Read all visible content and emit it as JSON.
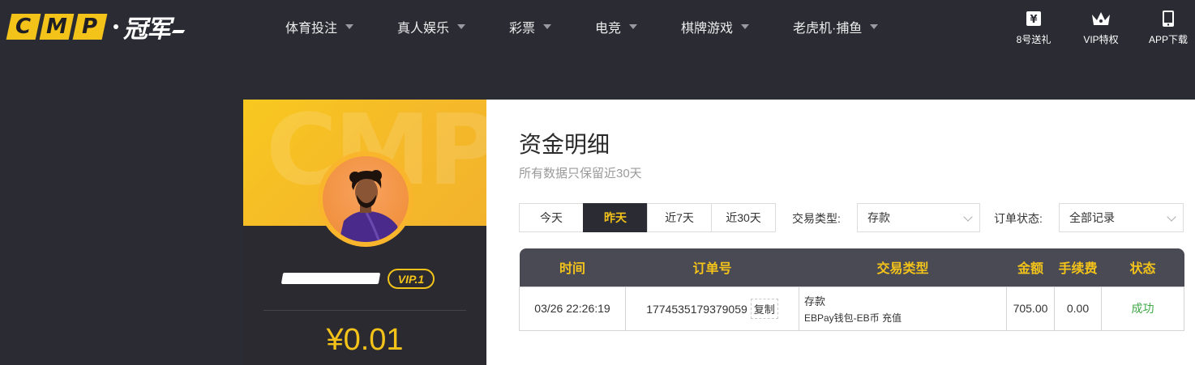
{
  "header": {
    "logo_letters": [
      "C",
      "M",
      "P"
    ],
    "logo_cn": "冠军",
    "nav": [
      {
        "label": "体育投注"
      },
      {
        "label": "真人娱乐"
      },
      {
        "label": "彩票"
      },
      {
        "label": "电竞"
      },
      {
        "label": "棋牌游戏"
      },
      {
        "label": "老虎机·捕鱼"
      }
    ],
    "tools": [
      {
        "label": "8号送礼",
        "icon": "yen-gift-icon"
      },
      {
        "label": "VIP特权",
        "icon": "crown-icon"
      },
      {
        "label": "APP下载",
        "icon": "phone-icon"
      }
    ]
  },
  "profile": {
    "watermark": "CMP",
    "vip": "VIP.1",
    "balance": "¥0.01"
  },
  "main": {
    "title": "资金明细",
    "subtitle": "所有数据只保留近30天",
    "range_tabs": [
      {
        "label": "今天",
        "active": false
      },
      {
        "label": "昨天",
        "active": true
      },
      {
        "label": "近7天",
        "active": false
      },
      {
        "label": "近30天",
        "active": false
      }
    ],
    "txn_type_label": "交易类型:",
    "txn_type_value": "存款",
    "order_status_label": "订单状态:",
    "order_status_value": "全部记录",
    "table": {
      "columns": [
        "时间",
        "订单号",
        "交易类型",
        "金额",
        "手续费",
        "状态"
      ],
      "rows": [
        {
          "time": "03/26 22:26:19",
          "order_no": "1774535179379059",
          "copy": "复制",
          "type_main": "存款",
          "type_sub": "EBPay钱包-EB币 充值",
          "amount": "705.00",
          "fee": "0.00",
          "status": "成功"
        }
      ]
    }
  },
  "colors": {
    "accent": "#f3c31a",
    "dark": "#2b2b34",
    "success": "#3fa847"
  }
}
